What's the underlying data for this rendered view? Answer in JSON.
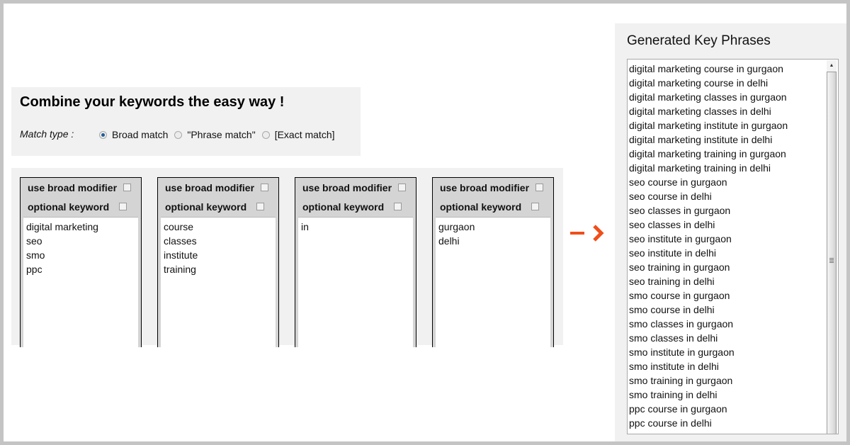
{
  "header": {
    "title": "Combine your keywords the easy way !",
    "match_type_label": "Match type :",
    "match_options": [
      {
        "label": "Broad match",
        "selected": true
      },
      {
        "label": "\"Phrase match\"",
        "selected": false
      },
      {
        "label": "[Exact match]",
        "selected": false
      }
    ]
  },
  "columns": [
    {
      "broad_modifier_label": "use broad modifier",
      "broad_modifier_checked": false,
      "optional_label": "optional keyword",
      "optional_checked": false,
      "keywords": [
        "digital marketing",
        "seo",
        "smo",
        "ppc"
      ]
    },
    {
      "broad_modifier_label": "use broad modifier",
      "broad_modifier_checked": false,
      "optional_label": "optional keyword",
      "optional_checked": false,
      "keywords": [
        "course",
        "classes",
        "institute",
        "training"
      ]
    },
    {
      "broad_modifier_label": "use broad modifier",
      "broad_modifier_checked": false,
      "optional_label": "optional keyword",
      "optional_checked": false,
      "keywords": [
        "in"
      ]
    },
    {
      "broad_modifier_label": "use broad modifier",
      "broad_modifier_checked": false,
      "optional_label": "optional keyword",
      "optional_checked": false,
      "keywords": [
        "gurgaon",
        "delhi"
      ]
    }
  ],
  "arrow": {
    "icon": "arrow-right-icon",
    "color": "#f04e1a"
  },
  "output": {
    "title": "Generated Key Phrases",
    "phrases": [
      "digital marketing course in gurgaon",
      "digital marketing course in delhi",
      "digital marketing classes in gurgaon",
      "digital marketing classes in delhi",
      "digital marketing institute in gurgaon",
      "digital marketing institute in delhi",
      "digital marketing training in gurgaon",
      "digital marketing training in delhi",
      "seo course in gurgaon",
      "seo course in delhi",
      "seo classes in gurgaon",
      "seo classes in delhi",
      "seo institute in gurgaon",
      "seo institute in delhi",
      "seo training in gurgaon",
      "seo training in delhi",
      "smo course in gurgaon",
      "smo course in delhi",
      "smo classes in gurgaon",
      "smo classes in delhi",
      "smo institute in gurgaon",
      "smo institute in delhi",
      "smo training in gurgaon",
      "smo training in delhi",
      "ppc course in gurgaon",
      "ppc course in delhi"
    ]
  }
}
